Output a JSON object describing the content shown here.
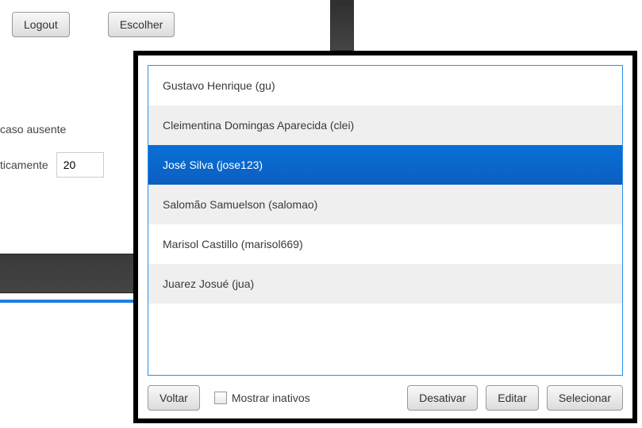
{
  "buttons": {
    "logout": "Logout",
    "escolher": "Escolher",
    "voltar": "Voltar",
    "desativar": "Desativar",
    "editar": "Editar",
    "selecionar": "Selecionar"
  },
  "background": {
    "label_ausente": "caso ausente",
    "label_auto": "ticamente",
    "auto_value": "20"
  },
  "modal": {
    "show_inactive_label": "Mostrar inativos",
    "items": [
      {
        "label": "Gustavo Henrique (gu)",
        "selected": false
      },
      {
        "label": "Cleimentina Domingas Aparecida (clei)",
        "selected": false
      },
      {
        "label": "José Silva (jose123)",
        "selected": true
      },
      {
        "label": "Salomão Samuelson (salomao)",
        "selected": false
      },
      {
        "label": "Marisol Castillo (marisol669)",
        "selected": false
      },
      {
        "label": "Juarez Josué (jua)",
        "selected": false
      }
    ]
  }
}
